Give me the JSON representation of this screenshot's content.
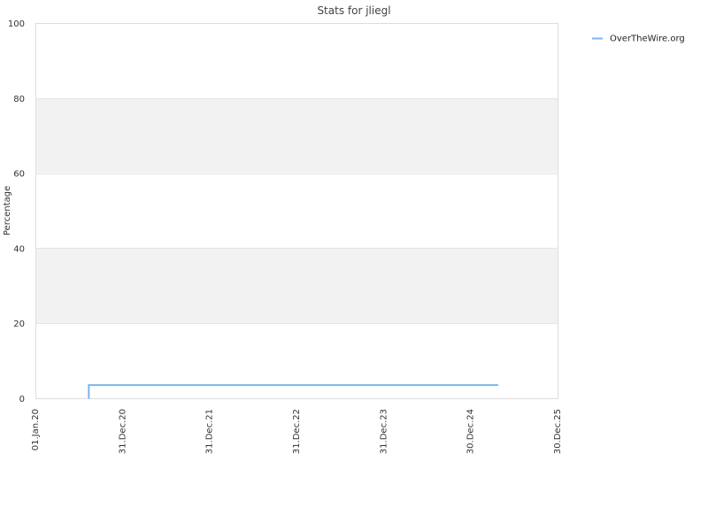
{
  "chart_data": {
    "type": "line",
    "title": "Stats for jliegl",
    "xlabel": "",
    "ylabel": "Percentage",
    "x_axis": {
      "type": "date",
      "range": [
        "2020-01-01",
        "2025-12-30"
      ],
      "ticks": [
        {
          "date": "2020-01-01",
          "label": "01.Jan.20"
        },
        {
          "date": "2020-12-31",
          "label": "31.Dec.20"
        },
        {
          "date": "2021-12-31",
          "label": "31.Dec.21"
        },
        {
          "date": "2022-12-31",
          "label": "31.Dec.22"
        },
        {
          "date": "2023-12-31",
          "label": "31.Dec.23"
        },
        {
          "date": "2024-12-30",
          "label": "30.Dec.24"
        },
        {
          "date": "2025-12-30",
          "label": "30.Dec.25"
        }
      ]
    },
    "y_axis": {
      "range": [
        0,
        100
      ],
      "ticks": [
        0,
        20,
        40,
        60,
        80,
        100
      ],
      "alternating_bands": true,
      "band_color": "#f2f2f2"
    },
    "grid": true,
    "legend": {
      "position": "top-right"
    },
    "series": [
      {
        "name": "OverTheWire.org",
        "color": "#7cb5ec",
        "step": true,
        "points": [
          {
            "x": "2020-08-10",
            "y": 0
          },
          {
            "x": "2020-08-12",
            "y": 3.5
          },
          {
            "x": "2025-04-25",
            "y": 3.5
          }
        ]
      }
    ]
  }
}
